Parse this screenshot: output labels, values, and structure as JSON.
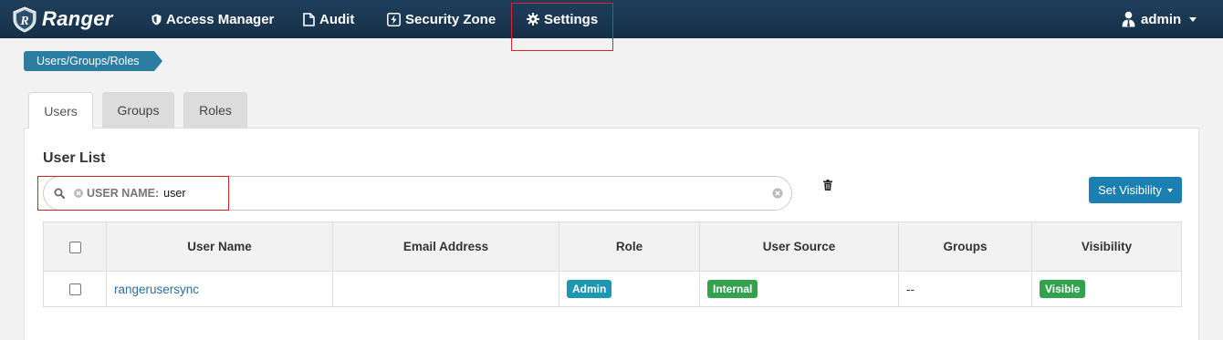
{
  "navbar": {
    "brand": "Ranger",
    "items": [
      {
        "label": "Access Manager",
        "icon": "shield-icon"
      },
      {
        "label": "Audit",
        "icon": "file-icon"
      },
      {
        "label": "Security Zone",
        "icon": "bolt-icon"
      },
      {
        "label": "Settings",
        "icon": "gear-icon"
      }
    ],
    "user": "admin"
  },
  "breadcrumb": [
    "Users/Groups/Roles"
  ],
  "tabs": [
    {
      "label": "Users",
      "active": true
    },
    {
      "label": "Groups",
      "active": false
    },
    {
      "label": "Roles",
      "active": false
    }
  ],
  "panel": {
    "title": "User List",
    "search": {
      "facet_key": "USER NAME:",
      "facet_value": "user"
    },
    "set_visibility_label": "Set Visibility"
  },
  "table": {
    "columns": [
      "User Name",
      "Email Address",
      "Role",
      "User Source",
      "Groups",
      "Visibility"
    ],
    "rows": [
      {
        "user_name": "rangerusersync",
        "email": "",
        "role": "Admin",
        "user_source": "Internal",
        "groups": "--",
        "visibility": "Visible"
      }
    ]
  },
  "colors": {
    "navbar": "#1f3f5d",
    "accent": "#1b80b1",
    "role_badge": "#1a98b0",
    "source_badge": "#33a24f",
    "visibility_badge": "#33a24f",
    "highlight": "#c9252b"
  }
}
